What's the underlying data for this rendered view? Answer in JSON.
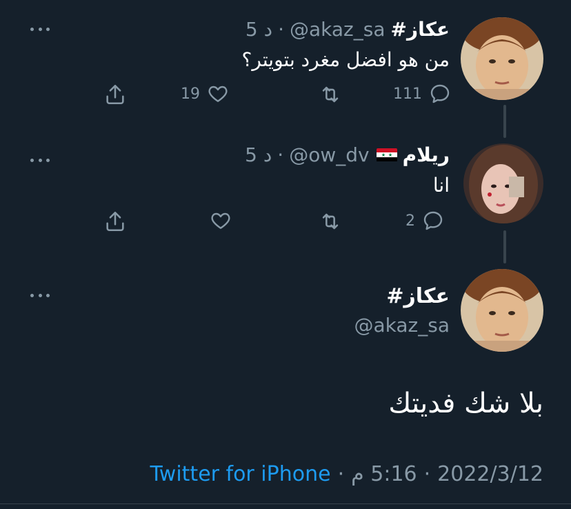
{
  "replies": [
    {
      "name": "#عكاز",
      "handle": "@akaz_sa",
      "time": "5 د",
      "text": "من هو افضل مغرد بتويتر؟",
      "replies_count": "111",
      "retweets_count": "",
      "likes_count": "19"
    },
    {
      "name": "ريلام",
      "handle": "@ow_dv",
      "time": "5 د",
      "text": "انا",
      "replies_count": "2",
      "retweets_count": "",
      "likes_count": ""
    }
  ],
  "main_tweet": {
    "name": "#عكاز",
    "handle": "@akaz_sa",
    "text": "بلا شك فديتك",
    "date": "2022/3/12",
    "time": "5:16 م",
    "source": "Twitter for iPhone"
  },
  "colors": {
    "background": "#15202b",
    "secondary_text": "#8899a6",
    "link": "#1d9bf0"
  }
}
